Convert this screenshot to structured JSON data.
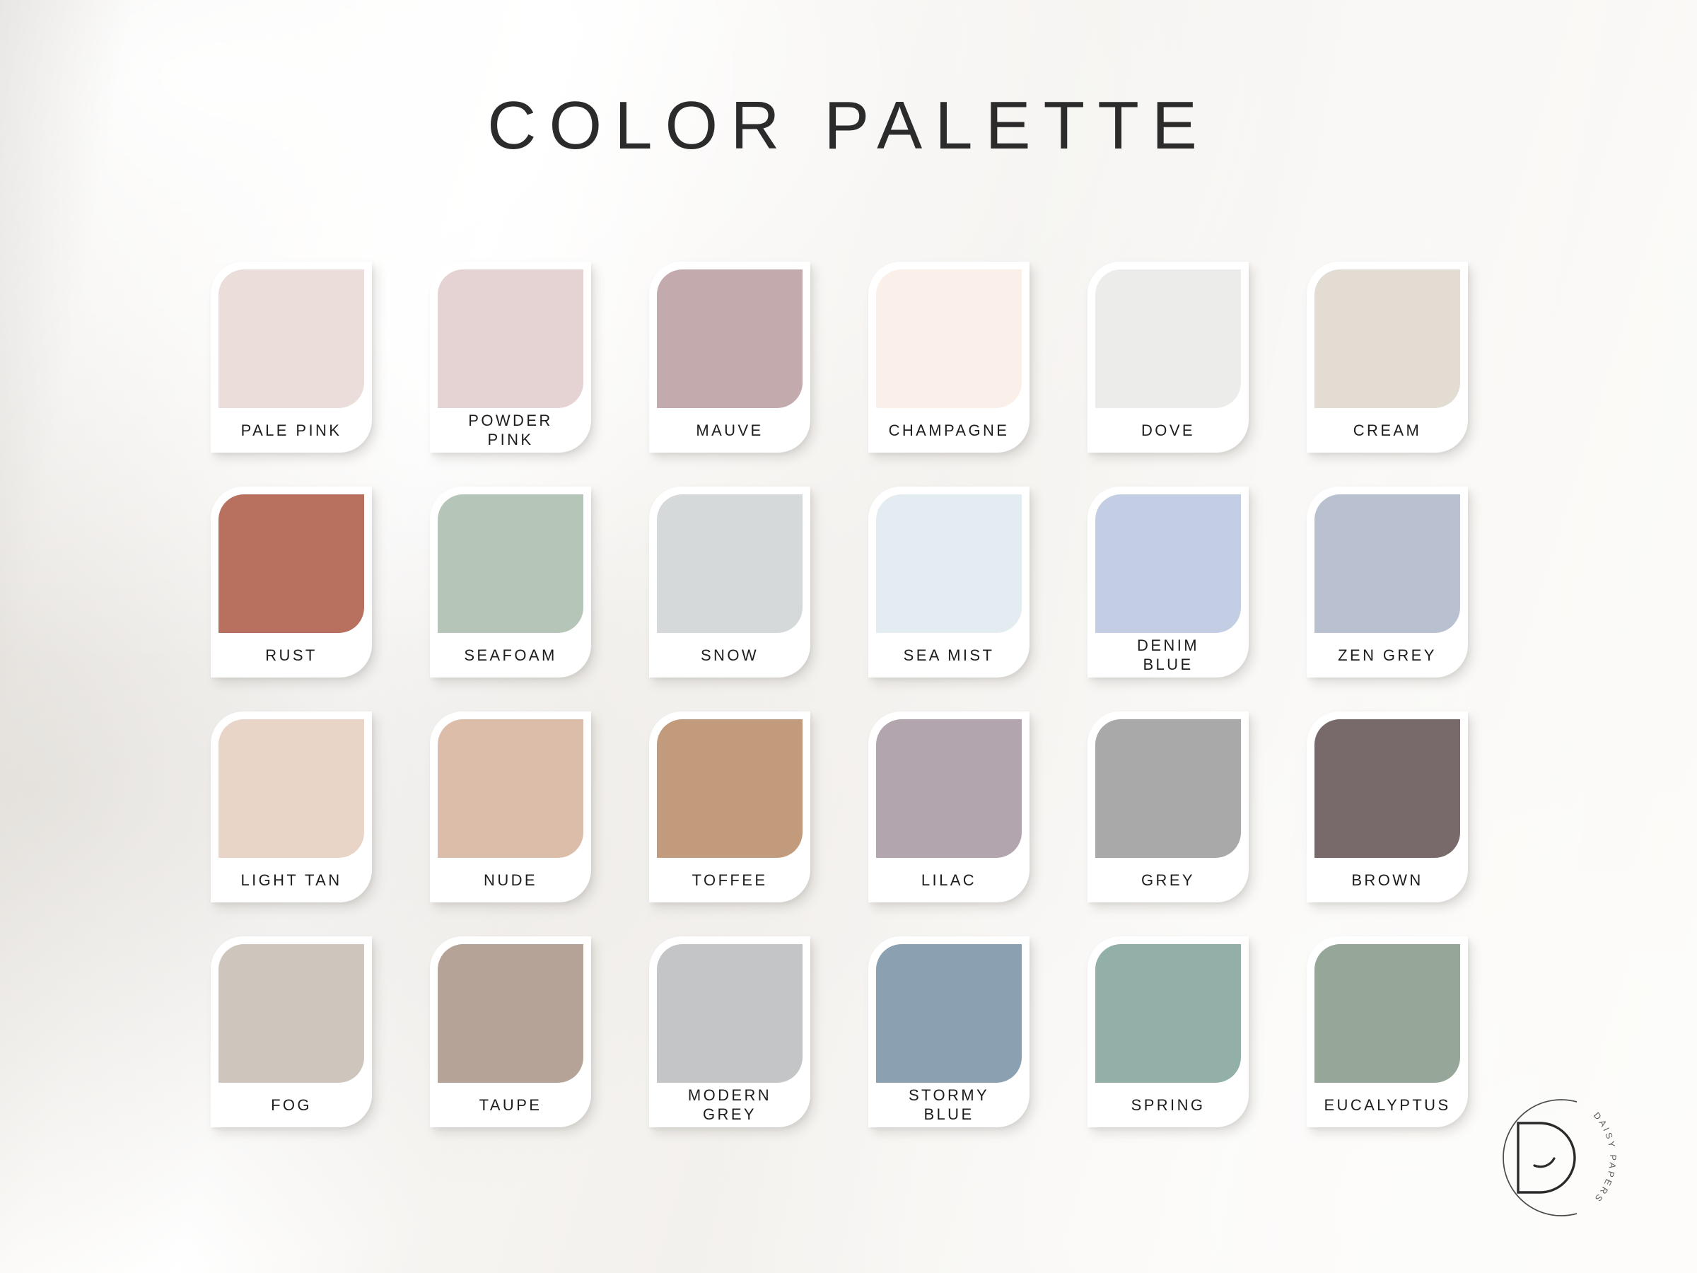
{
  "page": {
    "title": "COLOR PALETTE",
    "background_color": "#f6f4f1",
    "card_color": "#ffffff",
    "label_color": "#1d1d1d"
  },
  "brand": {
    "monogram": "D",
    "curved_text": "DAISY PAPERS",
    "logo_color": "#3a3a3a"
  },
  "chart_data": {
    "type": "table",
    "title": "COLOR PALETTE",
    "columns": 6,
    "rows": 4,
    "swatches": [
      {
        "name": "PALE PINK",
        "hex": "#eaddda"
      },
      {
        "name": "POWDER\nPINK",
        "hex": "#e5d2d2"
      },
      {
        "name": "MAUVE",
        "hex": "#c3aaac"
      },
      {
        "name": "CHAMPAGNE",
        "hex": "#faf0e9"
      },
      {
        "name": "DOVE",
        "hex": "#ececeb"
      },
      {
        "name": "CREAM",
        "hex": "#e3dcd3"
      },
      {
        "name": "RUST",
        "hex": "#b8705f"
      },
      {
        "name": "SEAFOAM",
        "hex": "#b5c5b8"
      },
      {
        "name": "SNOW",
        "hex": "#d6d9da"
      },
      {
        "name": "SEA MIST",
        "hex": "#e3ecf0"
      },
      {
        "name": "DENIM\nBLUE",
        "hex": "#c3cee4"
      },
      {
        "name": "ZEN GREY",
        "hex": "#b9c0cf"
      },
      {
        "name": "LIGHT TAN",
        "hex": "#e8d5c7"
      },
      {
        "name": "NUDE",
        "hex": "#dcbda9"
      },
      {
        "name": "TOFFEE",
        "hex": "#c29b7d"
      },
      {
        "name": "LILAC",
        "hex": "#b3a5ad"
      },
      {
        "name": "GREY",
        "hex": "#a9a9a9"
      },
      {
        "name": "BROWN",
        "hex": "#786a6a"
      },
      {
        "name": "FOG",
        "hex": "#cec5bd"
      },
      {
        "name": "TAUPE",
        "hex": "#b4a396"
      },
      {
        "name": "MODERN\nGREY",
        "hex": "#c3c5c7"
      },
      {
        "name": "STORMY\nBLUE",
        "hex": "#8ba0b0"
      },
      {
        "name": "SPRING",
        "hex": "#92b0a8"
      },
      {
        "name": "EUCALYPTUS",
        "hex": "#96a698"
      }
    ]
  }
}
